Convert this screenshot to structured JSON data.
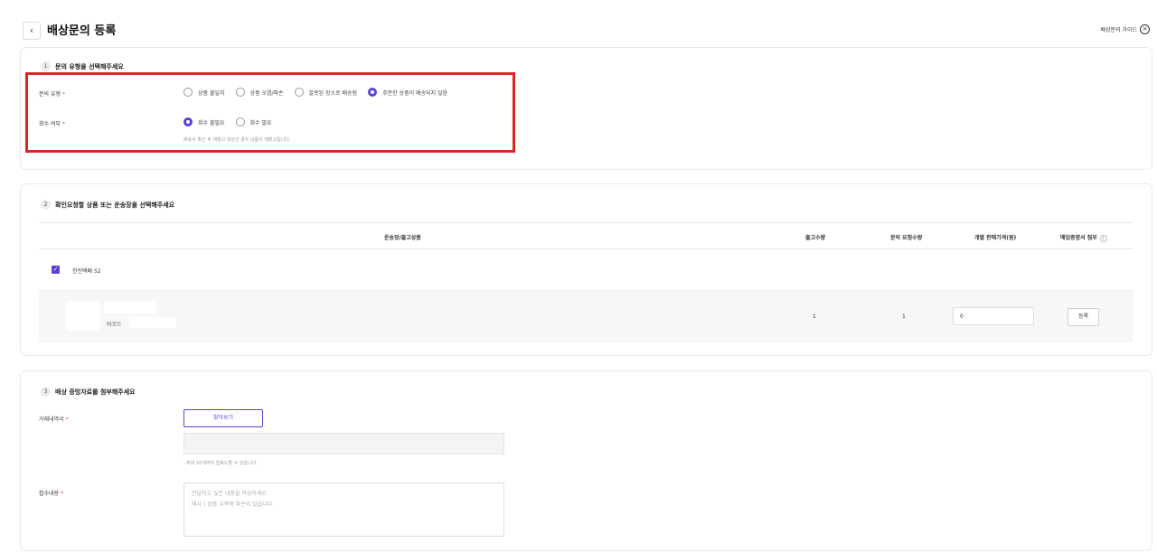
{
  "header": {
    "back_icon": "chevron-left-icon",
    "back_glyph": "‹",
    "title": "배상문의 등록",
    "guide_label": "배상문의 가이드",
    "guide_icon_glyph": "×"
  },
  "section1": {
    "step": "1",
    "title": "문의 유형을 선택해주세요",
    "inquiry_type": {
      "label": "문의 유형",
      "required_mark": "*",
      "options": [
        "상품 불일치",
        "상품 오염/파손",
        "잘못된 장소로 배송됨",
        "주문한 상품이 배송되지 않음"
      ],
      "selected": "주문한 상품이 배송되지 않음"
    },
    "retrieval": {
      "label": "회수 여부",
      "required_mark": "*",
      "options": [
        "회수 불필요",
        "회수 필요"
      ],
      "selected": "회수 불필요",
      "hint": "배송사 확인 후 재출고 대상인 경우 상품이 재출고됩니다."
    }
  },
  "section2": {
    "step": "2",
    "title": "확인요청할 상품 또는 운송장을 선택해주세요",
    "columns": [
      "운송장/출고상품",
      "출고수량",
      "문의 요청수량",
      "개별 판매가격(원)",
      "매입증명서 첨부"
    ],
    "info_glyph": "i",
    "carrier": {
      "checked": true,
      "check_glyph": "✓",
      "name": "한진택배 52"
    },
    "item": {
      "barcode_label": "바코드",
      "shipped_qty": "1",
      "request_qty": "1",
      "price_value": "0",
      "register_label": "등록"
    }
  },
  "section3": {
    "step": "3",
    "title": "배상 증빙자료를 첨부해주세요",
    "statement": {
      "label": "거래내역서",
      "required_mark": "*",
      "find_label": "찾아보기",
      "hint": "· 최대 10개까지 업로드할 수 있습니다."
    },
    "content": {
      "label": "접수내용",
      "required_mark": "*",
      "placeholder_line1": "전달하고 싶은 내용을 작성하세요.",
      "placeholder_line2": "예시 ) 상품 우측에 파손이 있습니다."
    }
  },
  "colors": {
    "accent": "#5b3fd0",
    "highlight_box": "#d92626",
    "required": "#e04b4b"
  }
}
